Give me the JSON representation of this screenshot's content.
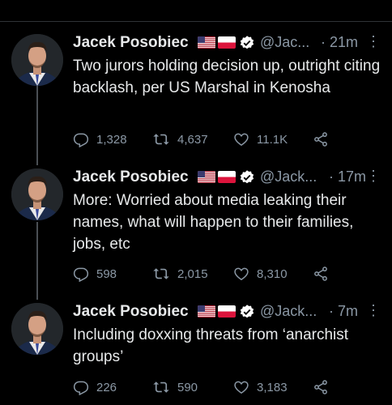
{
  "tweets": [
    {
      "name": "Jacek Posobiec",
      "flags": [
        "us-flag",
        "poland-flag"
      ],
      "verified": true,
      "handle": "@Jac...",
      "dot": "·",
      "time": "21m",
      "text": "Two jurors holding decision up, outright citing backlash, per US Marshal in Kenosha",
      "replies": "1,328",
      "retweets": "4,637",
      "likes": "11.1K"
    },
    {
      "name": "Jacek Posobiec",
      "flags": [
        "us-flag",
        "poland-flag"
      ],
      "verified": true,
      "handle": "@Jack...",
      "dot": "·",
      "time": "17m",
      "text": "More: Worried about media leaking their names, what will happen to their families, jobs, etc",
      "replies": "598",
      "retweets": "2,015",
      "likes": "8,310"
    },
    {
      "name": "Jacek Posobiec",
      "flags": [
        "us-flag",
        "poland-flag"
      ],
      "verified": true,
      "handle": "@Jack...",
      "dot": "·",
      "time": "7m",
      "text": "Including doxxing threats from ‘anarchist groups’",
      "replies": "226",
      "retweets": "590",
      "likes": "3,183"
    }
  ],
  "icons": {
    "reply": "reply-icon",
    "retweet": "retweet-icon",
    "like": "heart-icon",
    "share": "share-icon",
    "more": "more-icon",
    "verified": "verified-badge-icon"
  },
  "colors": {
    "background": "#000000",
    "text": "#e7e9ea",
    "muted": "#8b98a5",
    "verified": "#ffffff"
  }
}
